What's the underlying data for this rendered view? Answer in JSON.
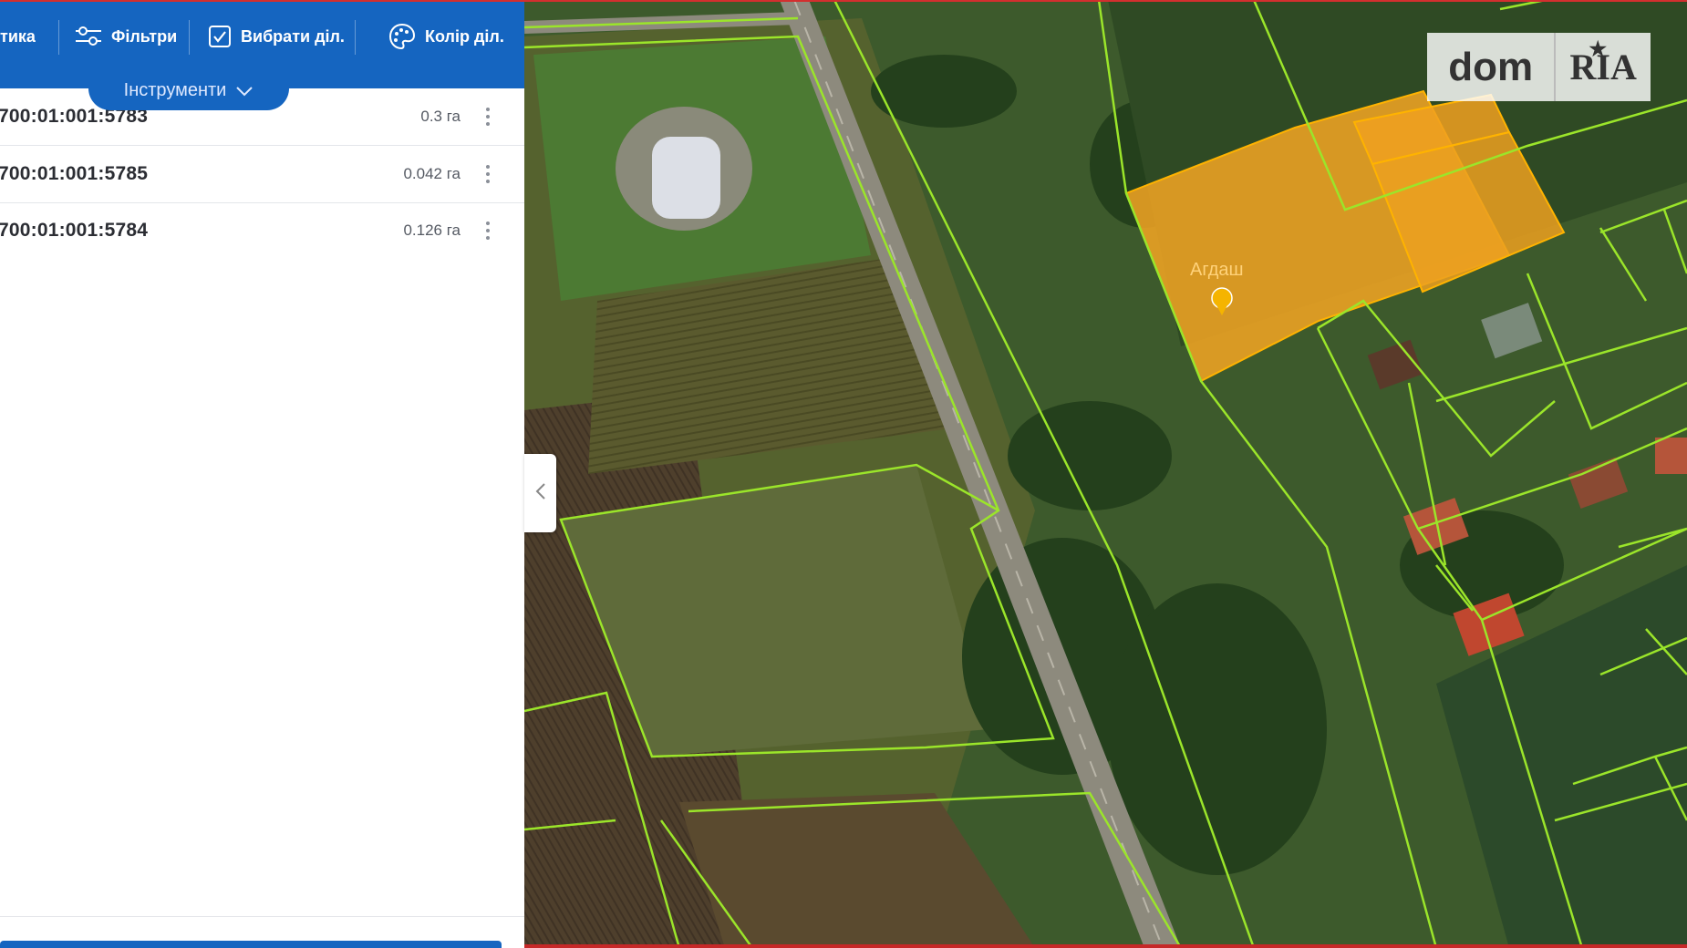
{
  "toolbar": {
    "items": [
      {
        "label": "тика",
        "icon": "analytics-icon"
      },
      {
        "label": "Фільтри",
        "icon": "filter-icon"
      },
      {
        "label": "Вибрати діл.",
        "icon": "checkbox-icon"
      },
      {
        "label": "Колір діл.",
        "icon": "palette-icon"
      }
    ],
    "tools_label": "Інструменти",
    "color": "#1565c0"
  },
  "parcels": [
    {
      "number": "700:01:001:5783",
      "area": "0.3 га"
    },
    {
      "number": "700:01:001:5785",
      "area": "0.042 га"
    },
    {
      "number": "700:01:001:5784",
      "area": "0.126 га"
    }
  ],
  "map": {
    "place_label": "Агдаш",
    "highlight_color": "#f5a623",
    "boundary_color": "#9be52a"
  },
  "logo": {
    "part1": "dom",
    "part2": "RIA"
  }
}
